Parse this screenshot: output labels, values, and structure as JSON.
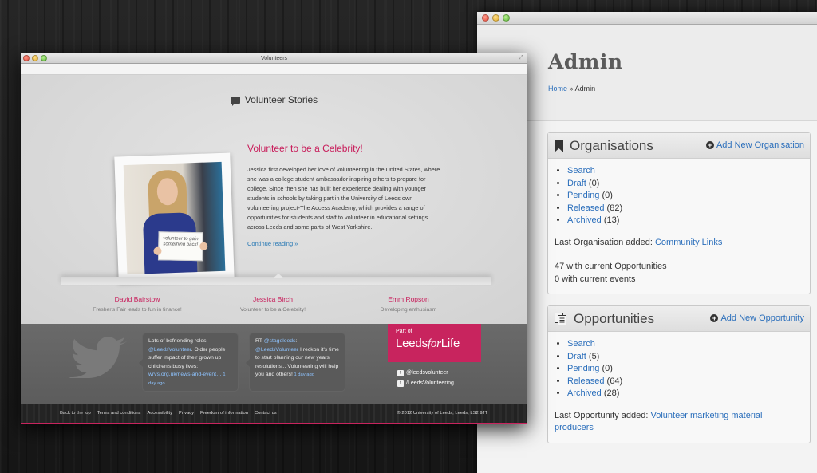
{
  "admin": {
    "title": "Admin",
    "breadcrumb": {
      "home": "Home",
      "separator": "»",
      "current": "Admin"
    },
    "organisations": {
      "title": "Organisations",
      "add_label": "Add New Organisation",
      "items": [
        {
          "label": "Search",
          "count": ""
        },
        {
          "label": "Draft",
          "count": "(0)"
        },
        {
          "label": "Pending",
          "count": "(0)"
        },
        {
          "label": "Released",
          "count": "(82)"
        },
        {
          "label": "Archived",
          "count": "(13)"
        }
      ],
      "last_added_label": "Last Organisation added:",
      "last_added_link": "Community Links",
      "current_opportunities": "47 with current Opportunities",
      "current_events": "0 with current events"
    },
    "opportunities": {
      "title": "Opportunities",
      "add_label": "Add New Opportunity",
      "items": [
        {
          "label": "Search",
          "count": ""
        },
        {
          "label": "Draft",
          "count": "(5)"
        },
        {
          "label": "Pending",
          "count": "(0)"
        },
        {
          "label": "Released",
          "count": "(64)"
        },
        {
          "label": "Archived",
          "count": "(28)"
        }
      ],
      "last_added_label": "Last Opportunity added:",
      "last_added_link": "Volunteer marketing material producers"
    }
  },
  "volunteers": {
    "window_title": "Volunteers",
    "section_title": "Volunteer Stories",
    "photo_sign": "volunteer to gain something back!",
    "story": {
      "title": "Volunteer to be a Celebrity!",
      "body": "Jessica first developed her love of volunteering in the United States, where she was a college student ambassador inspiring others to prepare for college. Since then she has built her experience dealing with younger students in schools by taking part in the University of Leeds own volunteering project-The Access Academy, which provides a range of opportunities for students and staff to volunteer in educational settings across Leeds and some parts of West Yorkshire.",
      "more": "Continue reading »"
    },
    "people": [
      {
        "name": "David Bairstow",
        "subtitle": "Fresher's Fair leads to fun in finance!"
      },
      {
        "name": "Jessica Birch",
        "subtitle": "Volunteer to be a Celebrity!"
      },
      {
        "name": "Emm Ropson",
        "subtitle": "Developing enthusiasm"
      }
    ],
    "tweets": [
      {
        "p1": "Lots of befriending roles ",
        "mention": "@LeedsVolunteer",
        "p2": ". Older people suffer impact of their grown up children's busy lives: ",
        "link": "wrvs.org.uk/news-and-event…",
        "ago": " 1 day ago"
      },
      {
        "p1": "RT ",
        "mention": "@stageleeds",
        "p2": ": ",
        "mention2": "@LeedsVolunteer",
        "p3": " I reckon it's time to start planning our new years resolutions... Volunteering will help you and others!",
        "ago": " 1 day ago"
      }
    ],
    "logo": {
      "part_of": "Part of",
      "leeds": "Leeds",
      "for": "for",
      "life": "Life"
    },
    "social": [
      {
        "icon": "twitter-icon",
        "glyph": "t",
        "label": "@leedsvolunteer"
      },
      {
        "icon": "facebook-icon",
        "glyph": "f",
        "label": "/LeedsVolunteering"
      }
    ],
    "footer_links": [
      "Back to the top",
      "Terms and conditions",
      "Accessibility",
      "Privacy",
      "Freedom of information",
      "Contact us"
    ],
    "copyright": "© 2012 University of Leeds, Leeds, LS2 9JT"
  }
}
